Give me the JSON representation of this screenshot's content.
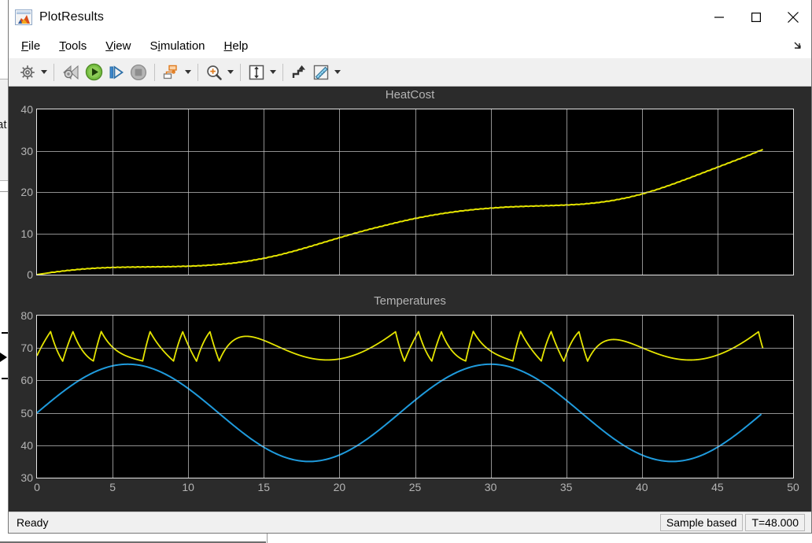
{
  "window": {
    "title": "PlotResults",
    "app_icon": "matlab-membrane-icon",
    "controls": {
      "minimize": "minimize-icon",
      "maximize": "maximize-icon",
      "close": "close-icon"
    }
  },
  "menu": {
    "items": [
      {
        "label": "File",
        "mnemonic": "F"
      },
      {
        "label": "Tools",
        "mnemonic": "T"
      },
      {
        "label": "View",
        "mnemonic": "V"
      },
      {
        "label": "Simulation",
        "mnemonic": "S"
      },
      {
        "label": "Help",
        "mnemonic": "H"
      }
    ],
    "overflow_icon": "overflow-arrow-icon"
  },
  "toolbar": {
    "buttons": [
      {
        "name": "configuration-properties",
        "icon": "gear-icon",
        "has_dropdown": true
      },
      {
        "name": "run-back-to-start",
        "icon": "rewind-sim-icon",
        "has_dropdown": false
      },
      {
        "name": "run",
        "icon": "play-icon",
        "has_dropdown": false
      },
      {
        "name": "step-forward",
        "icon": "step-forward-icon",
        "has_dropdown": false
      },
      {
        "name": "stop",
        "icon": "stop-icon",
        "has_dropdown": false
      },
      {
        "name": "signal-selection",
        "icon": "signal-blocks-icon",
        "has_dropdown": true
      },
      {
        "name": "zoom",
        "icon": "zoom-in-icon",
        "has_dropdown": true
      },
      {
        "name": "autoscale",
        "icon": "autoscale-icon",
        "has_dropdown": true
      },
      {
        "name": "scale-axes-limits",
        "icon": "scale-axes-icon",
        "has_dropdown": false
      },
      {
        "name": "cursor-measurements",
        "icon": "ruler-icon",
        "has_dropdown": true
      }
    ]
  },
  "plot": {
    "pin_icon": "pin-axes-icon",
    "background_color": "#000000",
    "panel_color": "#2b2b2b",
    "grid_color": "#c8c8c8",
    "tick_color": "#b4b4b4"
  },
  "status": {
    "message": "Ready",
    "frame_mode": "Sample based",
    "time": "T=48.000"
  },
  "background_window": {
    "label_fragment": "at"
  },
  "chart_data": [
    {
      "type": "line",
      "title": "HeatCost",
      "xlabel": "",
      "ylabel": "",
      "xlim": [
        0,
        50
      ],
      "ylim": [
        0,
        40
      ],
      "xticks": [
        0,
        5,
        10,
        15,
        20,
        25,
        30,
        35,
        40,
        45,
        50
      ],
      "yticks": [
        0,
        10,
        20,
        30,
        40
      ],
      "xticklabels": [
        "0",
        "5",
        "10",
        "15",
        "20",
        "25",
        "30",
        "35",
        "40",
        "45",
        "50"
      ],
      "yticklabels": [
        "0",
        "10",
        "20",
        "30",
        "40"
      ],
      "grid": true,
      "legend": "none",
      "series": [
        {
          "name": "HeatCost",
          "color": "#e5e500",
          "x": [
            0,
            1,
            2,
            3,
            4,
            5,
            6,
            7,
            8,
            9,
            10,
            11,
            12,
            13,
            14,
            15,
            16,
            17,
            18,
            19,
            20,
            21,
            22,
            23,
            24,
            25,
            26,
            27,
            28,
            29,
            30,
            31,
            32,
            33,
            34,
            35,
            36,
            37,
            38,
            39,
            40,
            41,
            42,
            43,
            44,
            45,
            46,
            47,
            48
          ],
          "y": [
            0.0,
            0.55,
            1.0,
            1.35,
            1.6,
            1.75,
            1.82,
            1.86,
            1.9,
            1.95,
            2.05,
            2.2,
            2.45,
            2.8,
            3.3,
            3.95,
            4.75,
            5.7,
            6.75,
            7.85,
            8.95,
            10.0,
            11.0,
            11.9,
            12.8,
            13.6,
            14.3,
            14.9,
            15.4,
            15.8,
            16.1,
            16.35,
            16.5,
            16.62,
            16.72,
            16.85,
            17.05,
            17.4,
            17.9,
            18.6,
            19.5,
            20.6,
            21.85,
            23.2,
            24.6,
            26.0,
            27.4,
            28.8,
            30.3
          ]
        }
      ]
    },
    {
      "type": "line",
      "title": "Temperatures",
      "xlabel": "",
      "ylabel": "",
      "xlim": [
        0,
        50
      ],
      "ylim": [
        30,
        80
      ],
      "xticks": [
        0,
        5,
        10,
        15,
        20,
        25,
        30,
        35,
        40,
        45,
        50
      ],
      "yticks": [
        30,
        40,
        50,
        60,
        70,
        80
      ],
      "xticklabels": [
        "0",
        "5",
        "10",
        "15",
        "20",
        "25",
        "30",
        "35",
        "40",
        "45",
        "50"
      ],
      "yticklabels": [
        "30",
        "40",
        "50",
        "60",
        "70",
        "80"
      ],
      "grid": true,
      "legend": "none",
      "series": [
        {
          "name": "OutdoorTemp",
          "color": "#1f9bdd",
          "description": "Sinusoidal outdoor temperature, mean 50, amplitude 15, period 24 h, starting at 50 rising",
          "mean": 50,
          "amplitude": 15,
          "period": 24,
          "phase_start_value": 50,
          "peaks": [
            {
              "x": 6,
              "y": 65
            },
            {
              "x": 30,
              "y": 65
            }
          ],
          "troughs": [
            {
              "x": 18,
              "y": 35
            },
            {
              "x": 42,
              "y": 35
            }
          ],
          "end": {
            "x": 48,
            "y": 50
          }
        },
        {
          "name": "IndoorTemp",
          "color": "#e5e500",
          "description": "Thermostat bang-bang sawtooth: fast heating ramp up to 75, exponential cooling decay down to 66; cycle rate varies with outdoor temperature (slow near warm peaks, fast near cold troughs)",
          "setpoint_high": 75,
          "setpoint_low": 66,
          "y_min": 65.5,
          "y_max": 75.5
        }
      ]
    }
  ]
}
